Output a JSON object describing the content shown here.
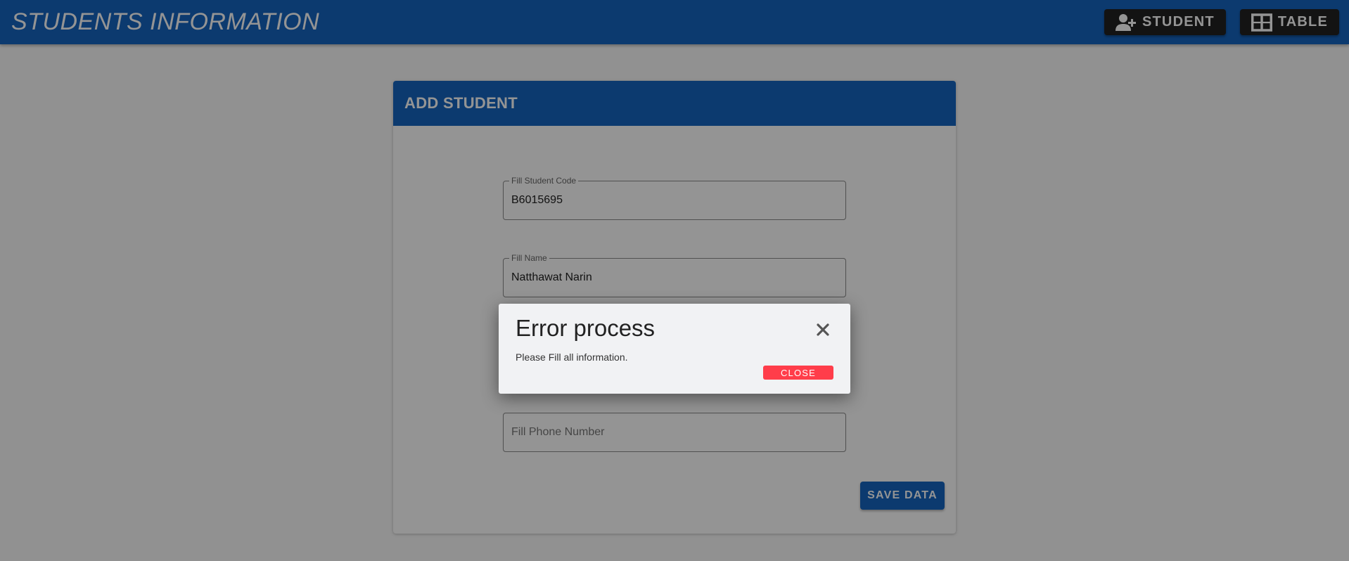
{
  "appbar": {
    "title": "STUDENTS INFORMATION",
    "buttons": [
      {
        "label": "STUDENT",
        "icon": "person-add-icon"
      },
      {
        "label": "TABLE",
        "icon": "table-icon"
      }
    ]
  },
  "form": {
    "title": "ADD STUDENT",
    "fields": [
      {
        "label": "Fill Student Code",
        "value": "B6015695"
      },
      {
        "label": "Fill Name",
        "value": "Natthawat Narin"
      },
      {
        "placeholder": "Fill Phone Number",
        "value": ""
      }
    ],
    "save_label": "SAVE DATA"
  },
  "dialog": {
    "title": "Error process",
    "message": "Please Fill all information.",
    "close_label": "CLOSE",
    "close_icon": "close-icon"
  },
  "colors": {
    "primary": "#1565c0",
    "nav_button": "#212121",
    "danger": "#ff3d4a",
    "dialog_bg": "#f1f2f4"
  }
}
